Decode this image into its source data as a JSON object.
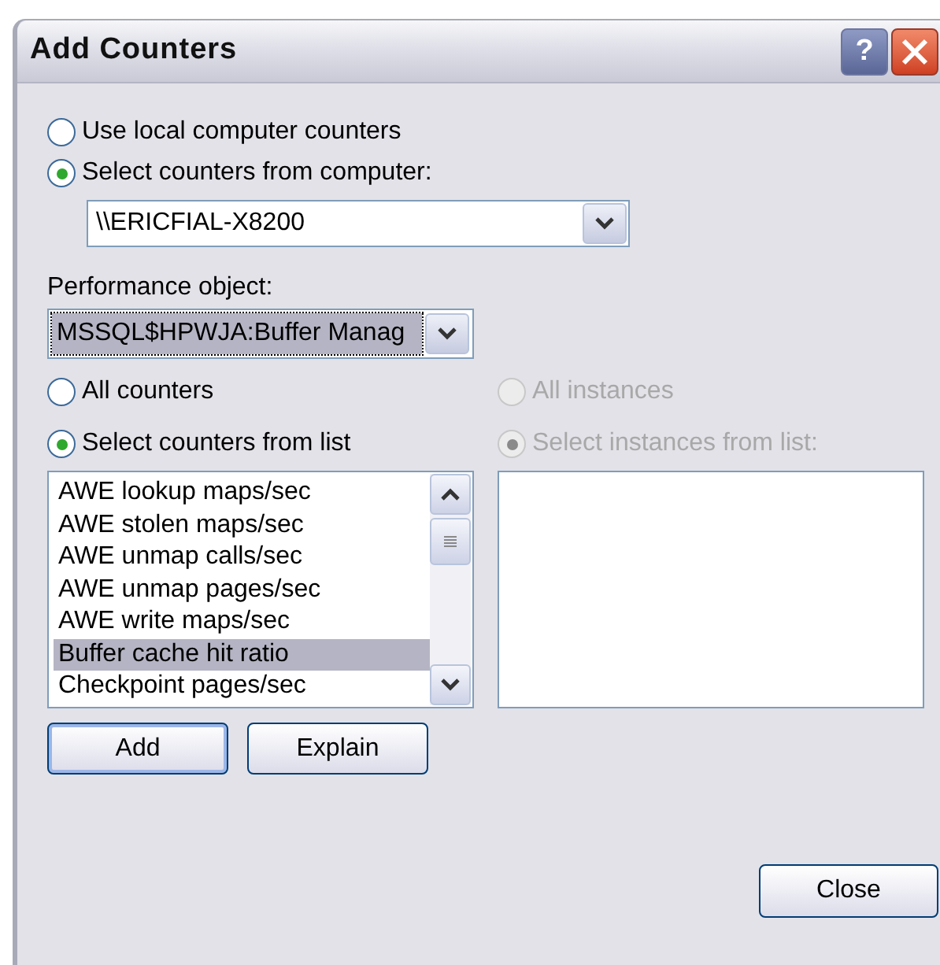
{
  "window": {
    "title": "Add Counters",
    "buttons": [
      "?"
    ]
  },
  "computer_source": [
    {
      "label": "Use local computer counters",
      "selected": false
    },
    {
      "label": "Select counters from computer:",
      "selected": true
    }
  ],
  "computer_combo": {
    "value": "\\\\ERICFIAL-X8200"
  },
  "performance_object": {
    "label": "Performance object:",
    "value": "MSSQL$HPWJA:Buffer Manag",
    "focused": true
  },
  "counter_mode": [
    {
      "label": "All counters",
      "selected": false,
      "disabled": false
    },
    {
      "label": "Select counters from list",
      "selected": true,
      "disabled": false
    }
  ],
  "instance_mode": [
    {
      "label": "All instances",
      "selected": false,
      "disabled": true
    },
    {
      "label": "Select instances from list:",
      "selected": true,
      "disabled": true
    }
  ],
  "counters": [
    {
      "label": "AWE lookup maps/sec",
      "selected": false
    },
    {
      "label": "AWE stolen maps/sec",
      "selected": false
    },
    {
      "label": "AWE unmap calls/sec",
      "selected": false
    },
    {
      "label": "AWE unmap pages/sec",
      "selected": false
    },
    {
      "label": "AWE write maps/sec",
      "selected": false
    },
    {
      "label": "Buffer cache hit ratio",
      "selected": true
    },
    {
      "label": "Checkpoint pages/sec",
      "selected": false
    }
  ],
  "action_buttons": [
    "Add",
    "Explain"
  ],
  "close_button": "Close"
}
